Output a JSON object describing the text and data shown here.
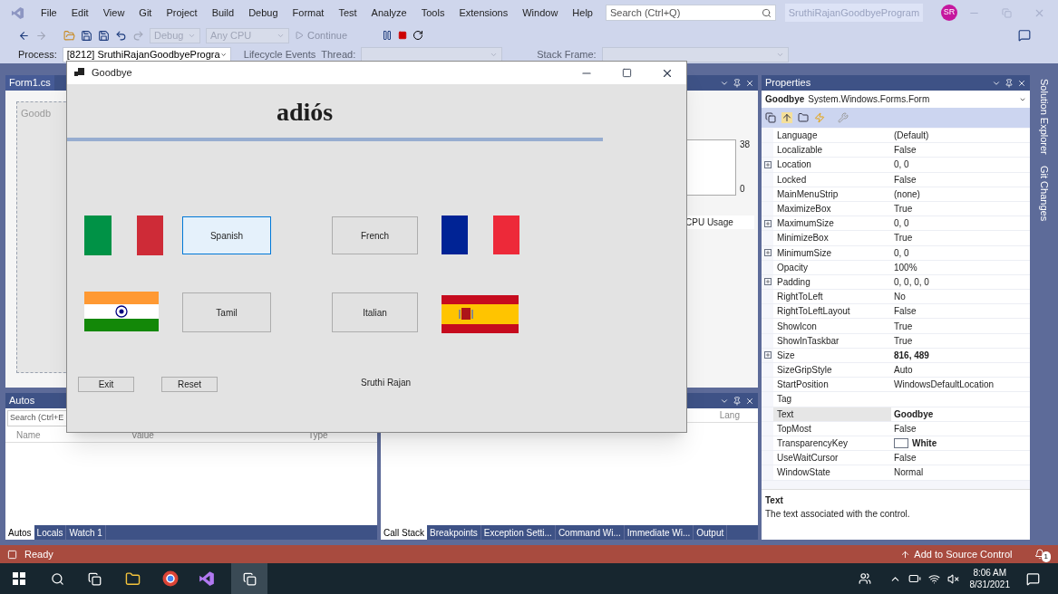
{
  "ide_title_bar": {
    "menus": [
      "File",
      "Edit",
      "View",
      "Git",
      "Project",
      "Build",
      "Debug",
      "Format",
      "Test",
      "Analyze",
      "Tools",
      "Extensions",
      "Window",
      "Help"
    ],
    "search": {
      "placeholder": "Search (Ctrl+Q)"
    },
    "solution_name": "SruthiRajanGoodbyeProgram",
    "avatar_initials": "SR"
  },
  "toolbar": {
    "configuration": "Debug",
    "platform": "Any CPU",
    "continue_label": "Continue"
  },
  "debug_location_bar": {
    "process_label": "Process:",
    "process": "[8212] SruthiRajanGoodbyeProgra",
    "lifecycle_events": "Lifecycle Events",
    "thread_label": "Thread:",
    "stack_frame_label": "Stack Frame:"
  },
  "designer_panel": {
    "tab": "Form1.cs",
    "form_caption": "Goodb"
  },
  "autos_panel": {
    "title": "Autos",
    "search": {
      "placeholder": "Search (Ctrl+E"
    },
    "columns": [
      "Name",
      "Value",
      "Type"
    ],
    "tabs": [
      {
        "label": "Autos",
        "selected": true
      },
      {
        "label": "Locals",
        "selected": false
      },
      {
        "label": "Watch 1",
        "selected": false
      }
    ]
  },
  "diagnostics_panel": {
    "axis_max": "38",
    "axis_min": "0",
    "tab": "CPU Usage"
  },
  "call_stack_panel": {
    "column": "Lang",
    "tabs": [
      {
        "label": "Call Stack",
        "selected": true
      },
      {
        "label": "Breakpoints",
        "selected": false
      },
      {
        "label": "Exception Setti...",
        "selected": false
      },
      {
        "label": "Command Wi...",
        "selected": false
      },
      {
        "label": "Immediate Wi...",
        "selected": false
      },
      {
        "label": "Output",
        "selected": false
      }
    ]
  },
  "properties": {
    "title": "Properties",
    "object_name": "Goodbye",
    "object_type": "System.Windows.Forms.Form",
    "rows": [
      {
        "name": "Language",
        "value": "(Default)",
        "expandable": false,
        "bold": false,
        "selected": false
      },
      {
        "name": "Localizable",
        "value": "False",
        "expandable": false,
        "bold": false,
        "selected": false
      },
      {
        "name": "Location",
        "value": "0, 0",
        "expandable": true,
        "bold": false,
        "selected": false
      },
      {
        "name": "Locked",
        "value": "False",
        "expandable": false,
        "bold": false,
        "selected": false
      },
      {
        "name": "MainMenuStrip",
        "value": "(none)",
        "expandable": false,
        "bold": false,
        "selected": false
      },
      {
        "name": "MaximizeBox",
        "value": "True",
        "expandable": false,
        "bold": false,
        "selected": false
      },
      {
        "name": "MaximumSize",
        "value": "0, 0",
        "expandable": true,
        "bold": false,
        "selected": false
      },
      {
        "name": "MinimizeBox",
        "value": "True",
        "expandable": false,
        "bold": false,
        "selected": false
      },
      {
        "name": "MinimumSize",
        "value": "0, 0",
        "expandable": true,
        "bold": false,
        "selected": false
      },
      {
        "name": "Opacity",
        "value": "100%",
        "expandable": false,
        "bold": false,
        "selected": false
      },
      {
        "name": "Padding",
        "value": "0, 0, 0, 0",
        "expandable": true,
        "bold": false,
        "selected": false
      },
      {
        "name": "RightToLeft",
        "value": "No",
        "expandable": false,
        "bold": false,
        "selected": false
      },
      {
        "name": "RightToLeftLayout",
        "value": "False",
        "expandable": false,
        "bold": false,
        "selected": false
      },
      {
        "name": "ShowIcon",
        "value": "True",
        "expandable": false,
        "bold": false,
        "selected": false
      },
      {
        "name": "ShowInTaskbar",
        "value": "True",
        "expandable": false,
        "bold": false,
        "selected": false
      },
      {
        "name": "Size",
        "value": "816, 489",
        "expandable": true,
        "bold": true,
        "selected": false
      },
      {
        "name": "SizeGripStyle",
        "value": "Auto",
        "expandable": false,
        "bold": false,
        "selected": false
      },
      {
        "name": "StartPosition",
        "value": "WindowsDefaultLocation",
        "expandable": false,
        "bold": false,
        "selected": false
      },
      {
        "name": "Tag",
        "expandable": false,
        "selected": false
      },
      {
        "name": "Text",
        "value": "Goodbye",
        "expandable": false,
        "bold": true,
        "selected": true
      },
      {
        "name": "TopMost",
        "value": "False",
        "expandable": false,
        "bold": false,
        "selected": false
      },
      {
        "name": "TransparencyKey",
        "value": "White",
        "kind": "color",
        "color": "#ffffff",
        "expandable": false,
        "bold": true,
        "selected": false
      },
      {
        "name": "UseWaitCursor",
        "value": "False",
        "expandable": false,
        "bold": false,
        "selected": false
      },
      {
        "name": "WindowState",
        "value": "Normal",
        "expandable": false,
        "bold": false,
        "selected": false
      }
    ],
    "description_title": "Text",
    "description": "The text associated with the control."
  },
  "side_tabs": [
    "Solution Explorer",
    "Git Changes"
  ],
  "status_bar": {
    "message": "Ready",
    "source_control": "Add to Source Control",
    "notifications": "1"
  },
  "taskbar": {
    "time": "8:06 AM",
    "date": "8/31/2021"
  },
  "form_window": {
    "title": "Goodbye",
    "heading": "adiós",
    "buttons": [
      {
        "label": "Spanish",
        "focused": true
      },
      {
        "label": "French",
        "focused": false
      },
      {
        "label": "Tamil",
        "focused": false
      },
      {
        "label": "Italian",
        "focused": false
      },
      {
        "label": "Exit",
        "focused": false
      },
      {
        "label": "Reset",
        "focused": false
      }
    ],
    "flags": [
      {
        "kind": "split",
        "color": "#009246"
      },
      {
        "kind": "split",
        "color": "#ce2b37"
      },
      {
        "kind": "split",
        "color": "#002395"
      },
      {
        "kind": "split",
        "color": "#ed2939"
      },
      {
        "kind": "india"
      },
      {
        "kind": "spain"
      }
    ],
    "author": "Sruthi Rajan"
  }
}
